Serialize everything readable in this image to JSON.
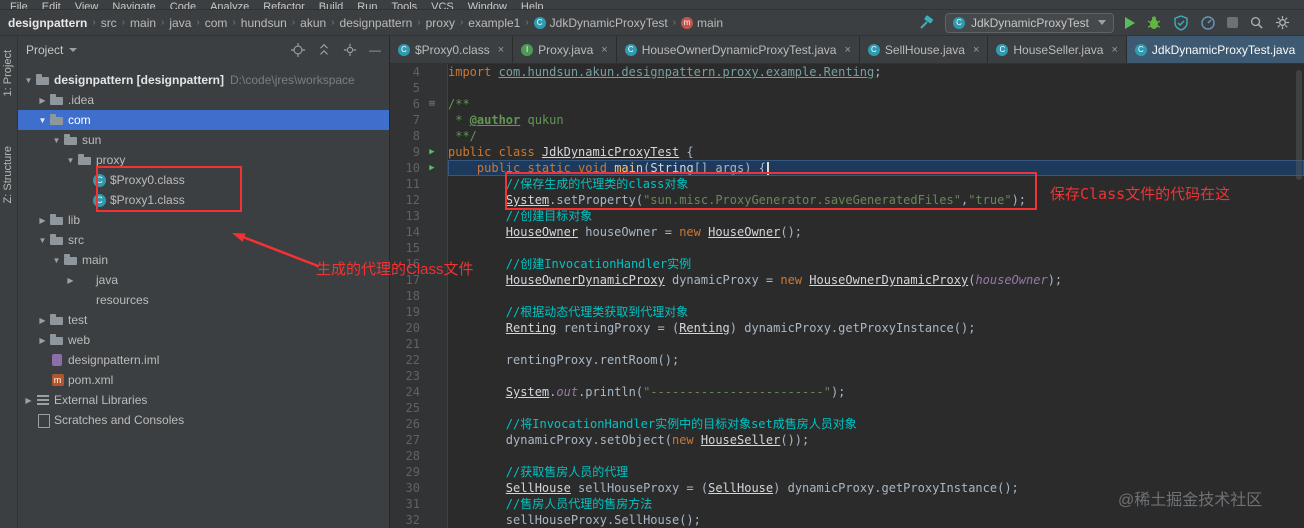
{
  "window": {
    "menu_items": [
      "File",
      "Edit",
      "View",
      "Navigate",
      "Code",
      "Analyze",
      "Refactor",
      "Build",
      "Run",
      "Tools",
      "VCS",
      "Window",
      "Help"
    ]
  },
  "breadcrumbs": {
    "root": "designpattern",
    "path": [
      "src",
      "main",
      "java",
      "com",
      "hundsun",
      "akun",
      "designpattern",
      "proxy",
      "example1"
    ],
    "class_item": "JdkDynamicProxyTest",
    "method_item": "main"
  },
  "toolbar": {
    "run_config": "JdkDynamicProxyTest"
  },
  "left_stripe": {
    "top": "1: Project",
    "bottom": "Z: Structure"
  },
  "project": {
    "header": "Project",
    "tree": [
      {
        "label": "designpattern",
        "suffix": " [designpattern]",
        "extra": "D:\\code\\jres\\workspace",
        "icon": "folder",
        "chev": "v",
        "indent": 0,
        "bold": true
      },
      {
        "label": ".idea",
        "icon": "folder",
        "chev": ">",
        "indent": 1
      },
      {
        "label": "com",
        "icon": "folder",
        "chev": "v",
        "indent": 1,
        "selected": true
      },
      {
        "label": "sun",
        "icon": "folder",
        "chev": "v",
        "indent": 2
      },
      {
        "label": "proxy",
        "icon": "folder",
        "chev": "v",
        "indent": 3
      },
      {
        "label": "$Proxy0.class",
        "icon": "class",
        "indent": 4
      },
      {
        "label": "$Proxy1.class",
        "icon": "class",
        "indent": 4
      },
      {
        "label": "lib",
        "icon": "folder",
        "chev": ">",
        "indent": 1
      },
      {
        "label": "src",
        "icon": "folder",
        "chev": "v",
        "indent": 1
      },
      {
        "label": "main",
        "icon": "folder",
        "chev": "v",
        "indent": 2
      },
      {
        "label": "java",
        "icon": "folder-src",
        "chev": ">",
        "indent": 3
      },
      {
        "label": "resources",
        "icon": "folder-res",
        "indent": 3
      },
      {
        "label": "test",
        "icon": "folder",
        "chev": ">",
        "indent": 1
      },
      {
        "label": "web",
        "icon": "folder",
        "chev": ">",
        "indent": 1
      },
      {
        "label": "designpattern.iml",
        "icon": "file-iml",
        "indent": 1
      },
      {
        "label": "pom.xml",
        "icon": "file-pom",
        "indent": 1
      },
      {
        "label": "External Libraries",
        "icon": "libs",
        "chev": ">",
        "indent": 0
      },
      {
        "label": "Scratches and Consoles",
        "icon": "scratch",
        "indent": 0
      }
    ]
  },
  "tabs": [
    {
      "label": "$Proxy0.class",
      "icon": "C",
      "active": false
    },
    {
      "label": "Proxy.java",
      "icon": "I",
      "active": false
    },
    {
      "label": "HouseOwnerDynamicProxyTest.java",
      "icon": "C",
      "active": false
    },
    {
      "label": "SellHouse.java",
      "icon": "C",
      "active": false
    },
    {
      "label": "HouseSeller.java",
      "icon": "C",
      "active": false
    },
    {
      "label": "JdkDynamicProxyTest.java",
      "icon": "C",
      "active": true
    }
  ],
  "editor": {
    "lines": [
      {
        "n": 4,
        "t": [
          [
            "kw",
            "import "
          ],
          [
            "imp",
            "com.hundsun.akun.designpattern.proxy.example.Renting"
          ],
          [
            "d",
            ";"
          ]
        ]
      },
      {
        "n": 5,
        "t": []
      },
      {
        "n": 6,
        "fold": true,
        "t": [
          [
            "doc",
            "/**"
          ]
        ]
      },
      {
        "n": 7,
        "t": [
          [
            "doc",
            " * "
          ],
          [
            "doctag",
            "@author"
          ],
          [
            "doc",
            " qukun"
          ]
        ]
      },
      {
        "n": 8,
        "t": [
          [
            "doc",
            " **/"
          ]
        ]
      },
      {
        "n": 9,
        "run": true,
        "t": [
          [
            "kw",
            "public class "
          ],
          [
            "cls",
            "JdkDynamicProxyTest"
          ],
          [
            "d",
            " {"
          ]
        ]
      },
      {
        "n": 10,
        "run": true,
        "sel": true,
        "caret": true,
        "t": [
          [
            "d",
            "    "
          ],
          [
            "kw",
            "public static void "
          ],
          [
            "mtd",
            "main"
          ],
          [
            "d",
            "("
          ],
          [
            "cls",
            "String"
          ],
          [
            "d",
            "[] args) {"
          ]
        ]
      },
      {
        "n": 11,
        "t": [
          [
            "d",
            "        "
          ],
          [
            "com",
            "//保存生成的代理类的class对象"
          ]
        ]
      },
      {
        "n": 12,
        "t": [
          [
            "d",
            "        "
          ],
          [
            "cls",
            "System"
          ],
          [
            "d",
            ".setProperty("
          ],
          [
            "str",
            "\"sun.misc.ProxyGenerator.saveGeneratedFiles\""
          ],
          [
            "d",
            ","
          ],
          [
            "str",
            "\"true\""
          ],
          [
            "d",
            ");"
          ]
        ]
      },
      {
        "n": 13,
        "t": [
          [
            "d",
            "        "
          ],
          [
            "com",
            "//创建目标对象"
          ]
        ]
      },
      {
        "n": 14,
        "t": [
          [
            "d",
            "        "
          ],
          [
            "cls",
            "HouseOwner"
          ],
          [
            "d",
            " houseOwner = "
          ],
          [
            "kw",
            "new "
          ],
          [
            "cls",
            "HouseOwner"
          ],
          [
            "d",
            "();"
          ]
        ]
      },
      {
        "n": 15,
        "t": []
      },
      {
        "n": 16,
        "t": [
          [
            "d",
            "        "
          ],
          [
            "com",
            "//创建InvocationHandler实例"
          ]
        ]
      },
      {
        "n": 17,
        "t": [
          [
            "d",
            "        "
          ],
          [
            "cls",
            "HouseOwnerDynamicProxy"
          ],
          [
            "d",
            " dynamicProxy = "
          ],
          [
            "kw",
            "new "
          ],
          [
            "cls",
            "HouseOwnerDynamicProxy"
          ],
          [
            "d",
            "("
          ],
          [
            "fld",
            "houseOwner"
          ],
          [
            "d",
            ");"
          ]
        ]
      },
      {
        "n": 18,
        "t": []
      },
      {
        "n": 19,
        "t": [
          [
            "d",
            "        "
          ],
          [
            "com",
            "//根据动态代理类获取到代理对象"
          ]
        ]
      },
      {
        "n": 20,
        "t": [
          [
            "d",
            "        "
          ],
          [
            "cls",
            "Renting"
          ],
          [
            "d",
            " rentingProxy = ("
          ],
          [
            "cls",
            "Renting"
          ],
          [
            "d",
            ") dynamicProxy.getProxyInstance();"
          ]
        ]
      },
      {
        "n": 21,
        "t": []
      },
      {
        "n": 22,
        "t": [
          [
            "d",
            "        rentingProxy.rentRoom();"
          ]
        ]
      },
      {
        "n": 23,
        "t": []
      },
      {
        "n": 24,
        "t": [
          [
            "d",
            "        "
          ],
          [
            "cls",
            "System"
          ],
          [
            "d",
            "."
          ],
          [
            "fld",
            "out"
          ],
          [
            "d",
            ".println("
          ],
          [
            "str",
            "\"------------------------\""
          ],
          [
            "d",
            ");"
          ]
        ]
      },
      {
        "n": 25,
        "t": []
      },
      {
        "n": 26,
        "t": [
          [
            "d",
            "        "
          ],
          [
            "com",
            "//将InvocationHandler实例中的目标对象set成售房人员对象"
          ]
        ]
      },
      {
        "n": 27,
        "t": [
          [
            "d",
            "        dynamicProxy.setObject("
          ],
          [
            "kw",
            "new "
          ],
          [
            "cls",
            "HouseSeller"
          ],
          [
            "d",
            "());"
          ]
        ]
      },
      {
        "n": 28,
        "t": []
      },
      {
        "n": 29,
        "t": [
          [
            "d",
            "        "
          ],
          [
            "com",
            "//获取售房人员的代理"
          ]
        ]
      },
      {
        "n": 30,
        "t": [
          [
            "d",
            "        "
          ],
          [
            "cls",
            "SellHouse"
          ],
          [
            "d",
            " sellHouseProxy = ("
          ],
          [
            "cls",
            "SellHouse"
          ],
          [
            "d",
            ") dynamicProxy.getProxyInstance();"
          ]
        ]
      },
      {
        "n": 31,
        "t": [
          [
            "d",
            "        "
          ],
          [
            "com",
            "//售房人员代理的售房方法"
          ]
        ]
      },
      {
        "n": 32,
        "t": [
          [
            "d",
            "        sellHouseProxy.SellHouse();"
          ]
        ]
      }
    ]
  },
  "annotations": {
    "tree_note": "生成的代理的Class文件",
    "code_note": "保存Class文件的代码在这"
  },
  "watermark": "@稀土掘金技术社区",
  "colors": {
    "accent_blue": "#3f6fcc",
    "annotation_red": "#f13333",
    "keyword_orange": "#cc7832",
    "comment_cyan": "#00c4c4",
    "string_green": "#6a8759",
    "run_green": "#58bd5b"
  }
}
